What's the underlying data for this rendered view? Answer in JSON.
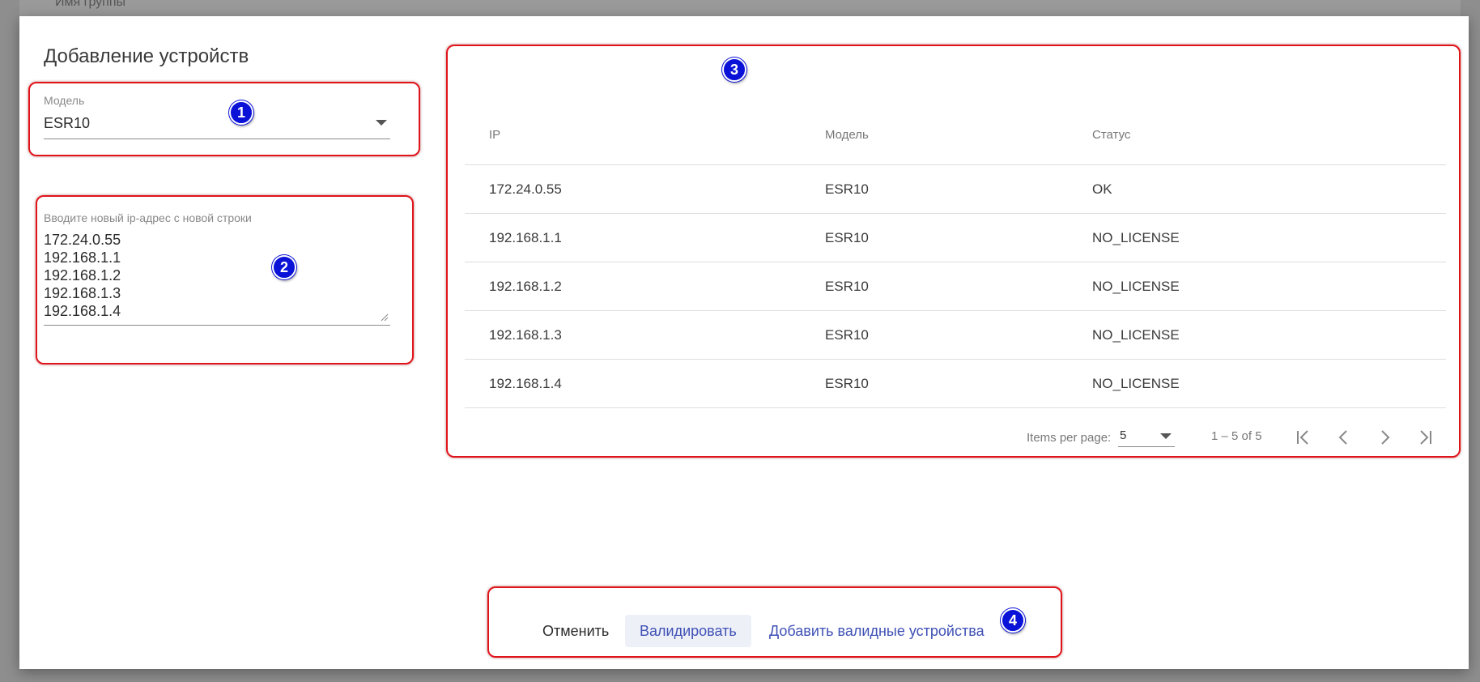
{
  "background": {
    "group_name_label": "Имя группы"
  },
  "dialog": {
    "title": "Добавление устройств",
    "model_field": {
      "label": "Модель",
      "value": "ESR10"
    },
    "ip_field": {
      "label": "Вводите новый ip-адрес с новой строки",
      "lines": [
        "172.24.0.55",
        "192.168.1.1",
        "192.168.1.2",
        "192.168.1.3",
        "192.168.1.4"
      ]
    },
    "table": {
      "columns": [
        "IP",
        "Модель",
        "Статус"
      ],
      "rows": [
        {
          "ip": "172.24.0.55",
          "model": "ESR10",
          "status": "OK"
        },
        {
          "ip": "192.168.1.1",
          "model": "ESR10",
          "status": "NO_LICENSE"
        },
        {
          "ip": "192.168.1.2",
          "model": "ESR10",
          "status": "NO_LICENSE"
        },
        {
          "ip": "192.168.1.3",
          "model": "ESR10",
          "status": "NO_LICENSE"
        },
        {
          "ip": "192.168.1.4",
          "model": "ESR10",
          "status": "NO_LICENSE"
        }
      ]
    },
    "paginator": {
      "items_per_page_label": "Items per page:",
      "page_size": "5",
      "range_label": "1 – 5 of 5",
      "first_icon": "first-page-icon",
      "prev_icon": "chevron-left-icon",
      "next_icon": "chevron-right-icon",
      "last_icon": "last-page-icon"
    },
    "buttons": {
      "cancel": "Отменить",
      "validate": "Валидировать",
      "add_valid": "Добавить валидные устройства"
    }
  },
  "annotations": [
    {
      "number": "1"
    },
    {
      "number": "2"
    },
    {
      "number": "3"
    },
    {
      "number": "4"
    }
  ],
  "colors": {
    "accent": "#3f51b5",
    "annotation_red": "#e0141b",
    "annotation_badge": "#0a12d8"
  }
}
